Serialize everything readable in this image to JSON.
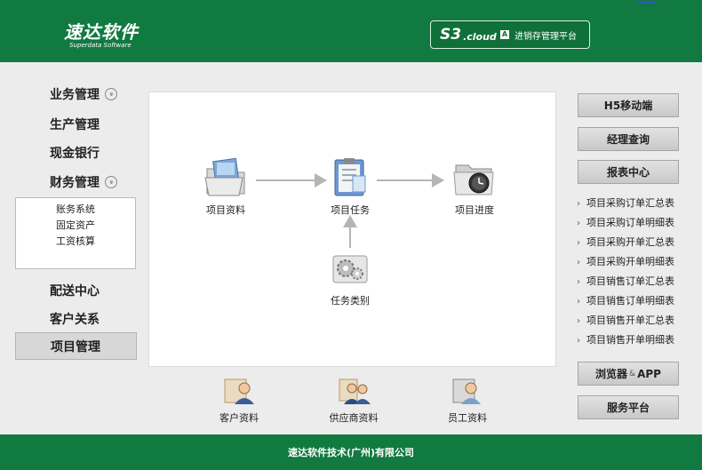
{
  "header": {
    "logo_text": "速达软件",
    "logo_sub": "Superdata Software",
    "brand_s3": "S3",
    "brand_cloud": ".cloud",
    "brand_badge": "A",
    "brand_name": "进销存管理平台",
    "bg_color": "#117a41"
  },
  "nav": {
    "items": [
      {
        "label": "业务管理",
        "expandable": true
      },
      {
        "label": "生产管理"
      },
      {
        "label": "现金银行"
      },
      {
        "label": "财务管理",
        "expandable": true
      },
      {
        "label": "配送中心"
      },
      {
        "label": "客户关系"
      }
    ],
    "finance_sub": [
      "账务系统",
      "固定资产",
      "工资核算"
    ],
    "active": "项目管理",
    "chevron_glyph": "»"
  },
  "flow": {
    "nodes": [
      {
        "label": "项目资料",
        "icon": "folder-documents-icon"
      },
      {
        "label": "项目任务",
        "icon": "clipboard-task-icon"
      },
      {
        "label": "项目进度",
        "icon": "folder-clock-icon"
      },
      {
        "label": "任务类别",
        "icon": "gears-icon"
      }
    ]
  },
  "bottom_links": [
    {
      "label": "客户资料",
      "icon": "customer-icon"
    },
    {
      "label": "供应商资料",
      "icon": "supplier-icon"
    },
    {
      "label": "员工资料",
      "icon": "employee-icon"
    }
  ],
  "right": {
    "buttons": [
      "H5移动端",
      "经理查询",
      "报表中心"
    ],
    "reports": [
      "项目采购订单汇总表",
      "项目采购订单明细表",
      "项目采购开单汇总表",
      "项目采购开单明细表",
      "项目销售订单汇总表",
      "项目销售订单明细表",
      "项目销售开单汇总表",
      "项目销售开单明细表"
    ],
    "browser_app": {
      "left": "浏览器",
      "amp": "&",
      "right": "APP"
    },
    "service": "服务平台"
  },
  "footer": {
    "text": "速达软件技术(广州)有限公司"
  }
}
